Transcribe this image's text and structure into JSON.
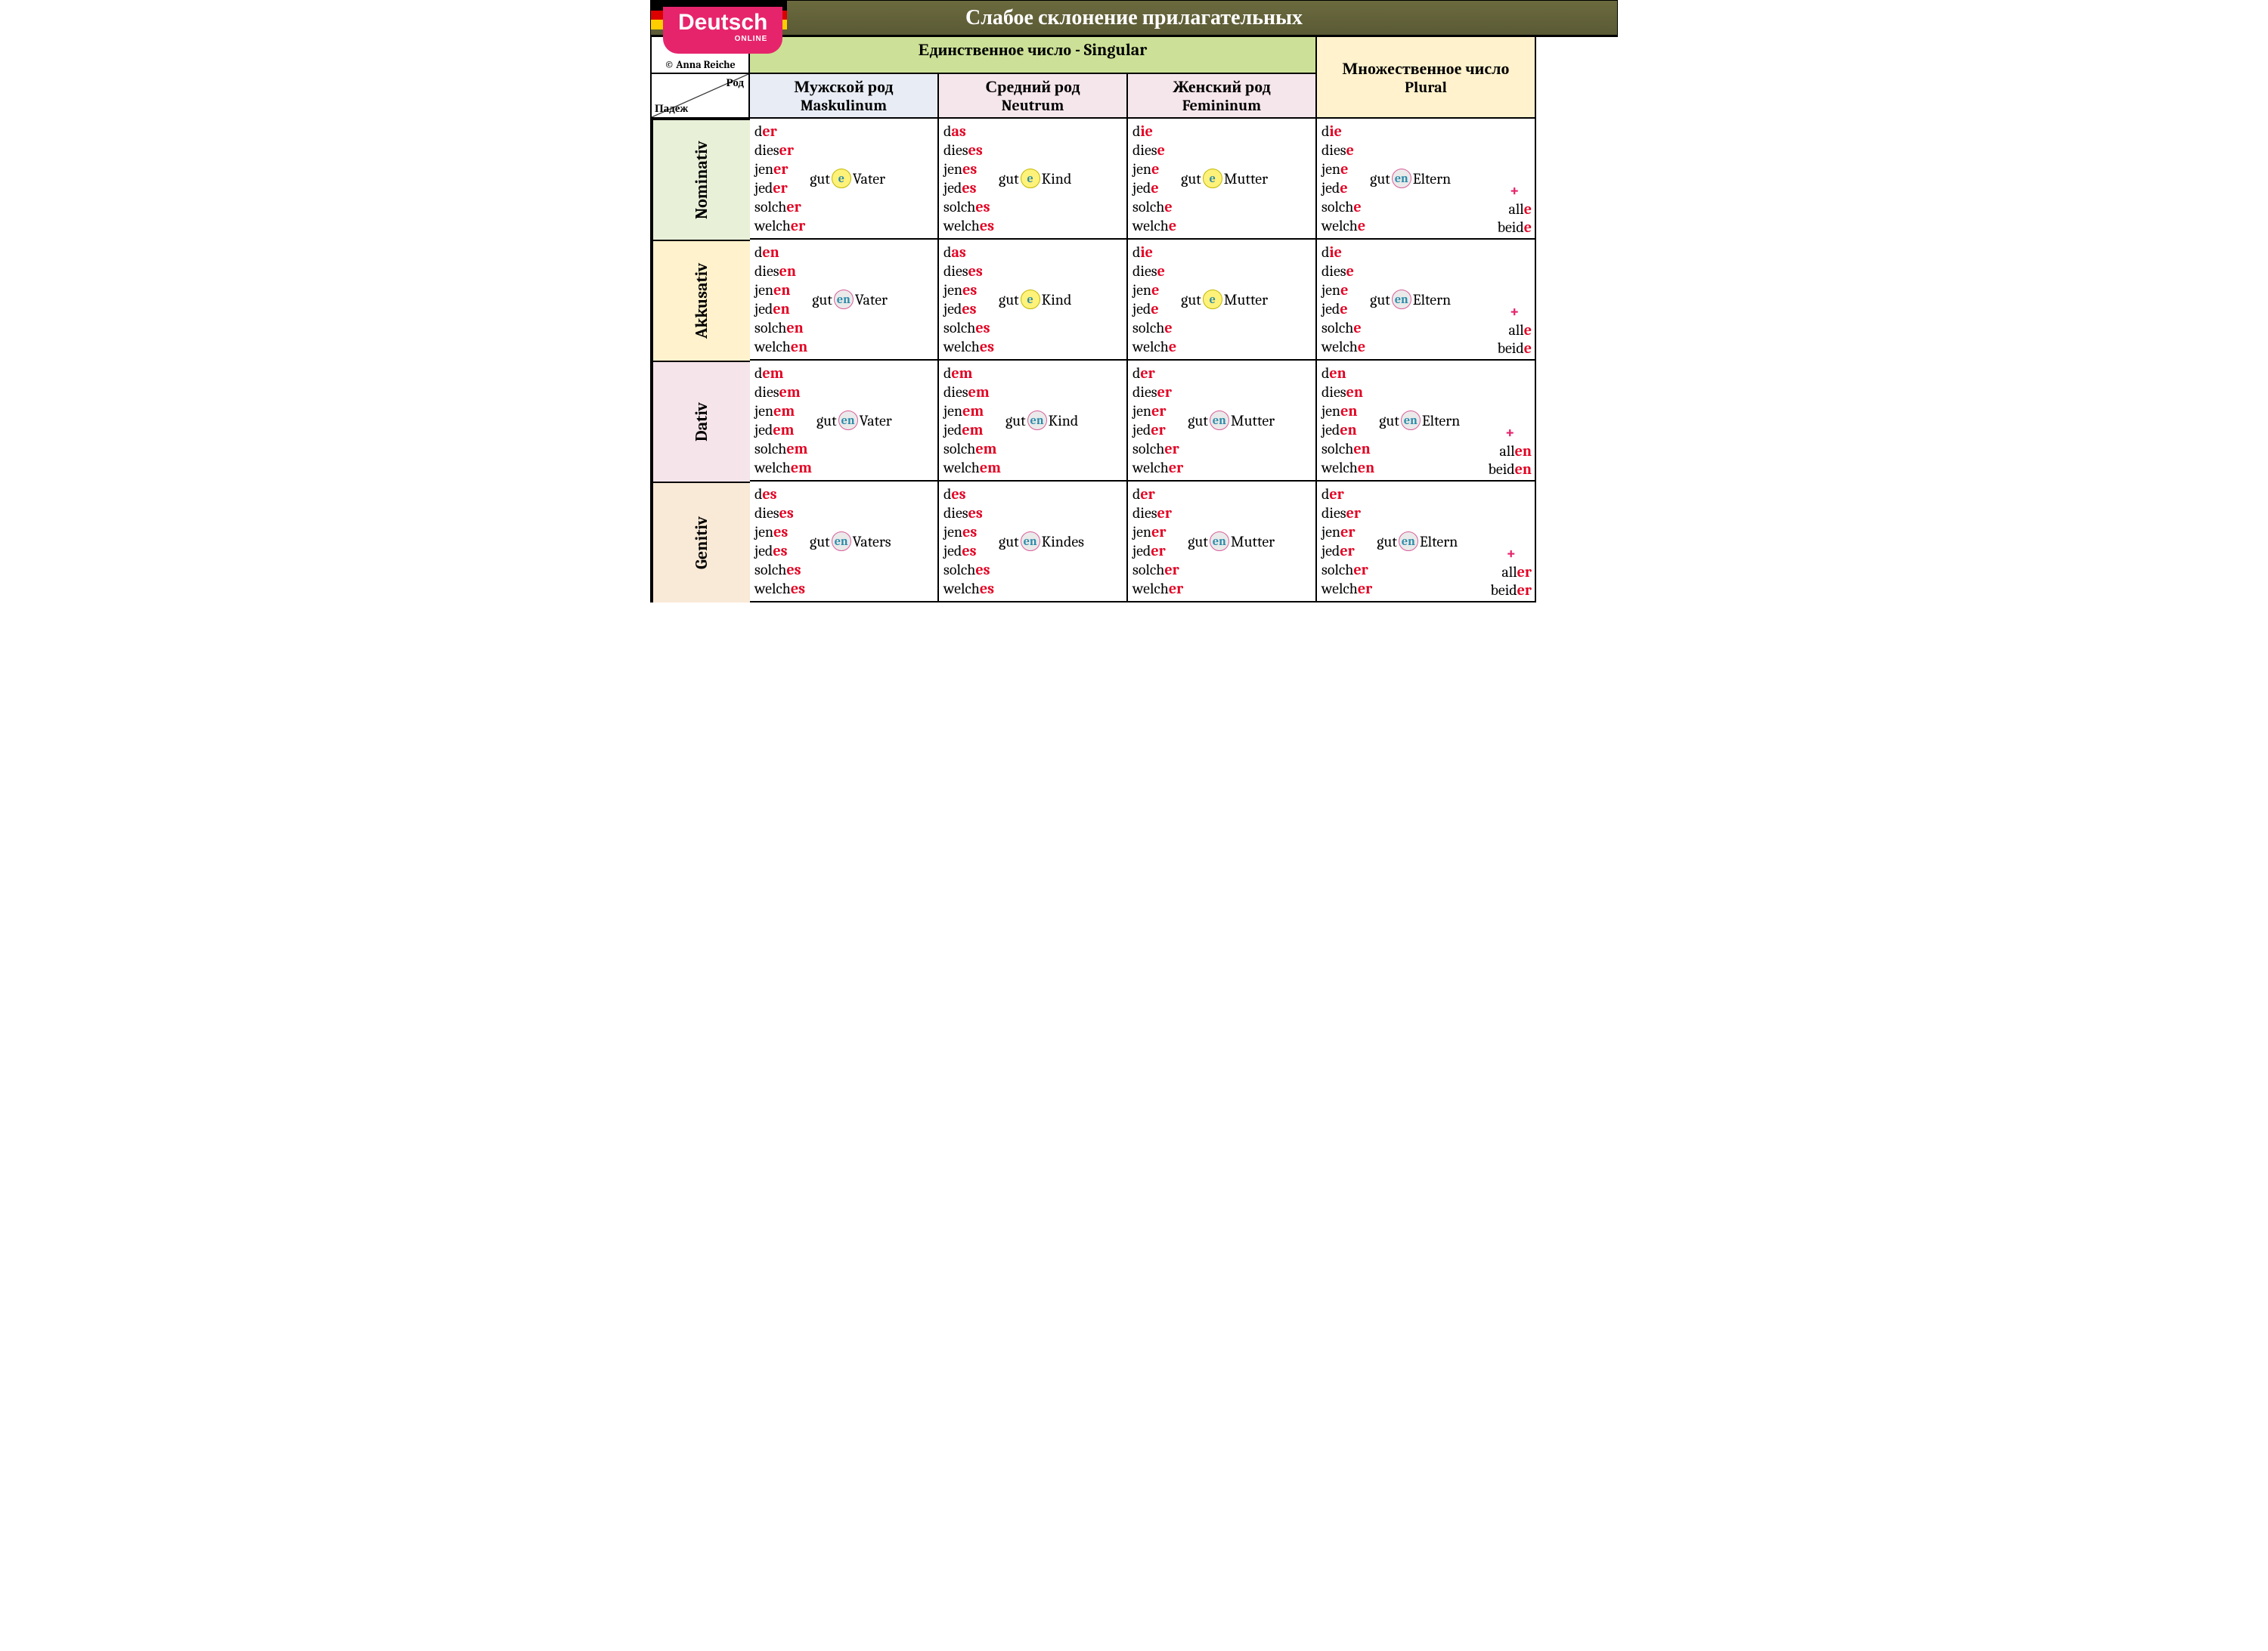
{
  "title": "Слабое склонение прилагательных",
  "logo": {
    "main": "Deutsch",
    "sub": "ONLINE"
  },
  "credit": "© Anna Reiche",
  "headers": {
    "singular": "Единственное число   -   Singular",
    "plural": "Множественное число",
    "plural_sub": "Plural",
    "rod": "Род",
    "padezh": "Падеж",
    "cols": [
      {
        "ru": "Мужской род",
        "de": "Maskulinum"
      },
      {
        "ru": "Средний род",
        "de": "Neutrum"
      },
      {
        "ru": "Женский род",
        "de": "Femininum"
      }
    ]
  },
  "cases": [
    "Nominativ",
    "Akkusativ",
    "Dativ",
    "Genitiv"
  ],
  "case_bg": [
    "bg-mint",
    "bg-yellow",
    "bg-rose",
    "bg-peach"
  ],
  "adj_stem": "gut",
  "nouns": {
    "m": "Vater",
    "n": "Kind",
    "f": "Mutter",
    "p": "Eltern",
    "m_gen": "Vaters",
    "n_gen": "Kindes"
  },
  "rows": [
    {
      "m": {
        "det": [
          [
            "d",
            "er"
          ],
          [
            "dies",
            "er"
          ],
          [
            "jen",
            "er"
          ],
          [
            "jed",
            "er"
          ],
          [
            "solch",
            "er"
          ],
          [
            "welch",
            "er"
          ]
        ],
        "end": "e",
        "circ": "e",
        "noun": "Vater"
      },
      "n": {
        "det": [
          [
            "d",
            "as"
          ],
          [
            "dies",
            "es"
          ],
          [
            "jen",
            "es"
          ],
          [
            "jed",
            "es"
          ],
          [
            "solch",
            "es"
          ],
          [
            "welch",
            "es"
          ]
        ],
        "end": "e",
        "circ": "e",
        "noun": "Kind"
      },
      "f": {
        "det": [
          [
            "d",
            "ie"
          ],
          [
            "dies",
            "e"
          ],
          [
            "jen",
            "e"
          ],
          [
            "jed",
            "e"
          ],
          [
            "solch",
            "e"
          ],
          [
            "welch",
            "e"
          ]
        ],
        "end": "e",
        "circ": "e",
        "noun": "Mutter"
      },
      "p": {
        "det": [
          [
            "d",
            "ie"
          ],
          [
            "dies",
            "e"
          ],
          [
            "jen",
            "e"
          ],
          [
            "jed",
            "e"
          ],
          [
            "solch",
            "e"
          ],
          [
            "welch",
            "e"
          ]
        ],
        "end": "en",
        "circ": "en",
        "noun": "Eltern",
        "extra": [
          [
            "all",
            "e"
          ],
          [
            "beid",
            "e"
          ]
        ]
      }
    },
    {
      "m": {
        "det": [
          [
            "d",
            "en"
          ],
          [
            "dies",
            "en"
          ],
          [
            "jen",
            "en"
          ],
          [
            "jed",
            "en"
          ],
          [
            "solch",
            "en"
          ],
          [
            "welch",
            "en"
          ]
        ],
        "end": "en",
        "circ": "en",
        "noun": "Vater"
      },
      "n": {
        "det": [
          [
            "d",
            "as"
          ],
          [
            "dies",
            "es"
          ],
          [
            "jen",
            "es"
          ],
          [
            "jed",
            "es"
          ],
          [
            "solch",
            "es"
          ],
          [
            "welch",
            "es"
          ]
        ],
        "end": "e",
        "circ": "e",
        "noun": "Kind"
      },
      "f": {
        "det": [
          [
            "d",
            "ie"
          ],
          [
            "dies",
            "e"
          ],
          [
            "jen",
            "e"
          ],
          [
            "jed",
            "e"
          ],
          [
            "solch",
            "e"
          ],
          [
            "welch",
            "e"
          ]
        ],
        "end": "e",
        "circ": "e",
        "noun": "Mutter"
      },
      "p": {
        "det": [
          [
            "d",
            "ie"
          ],
          [
            "dies",
            "e"
          ],
          [
            "jen",
            "e"
          ],
          [
            "jed",
            "e"
          ],
          [
            "solch",
            "e"
          ],
          [
            "welch",
            "e"
          ]
        ],
        "end": "en",
        "circ": "en",
        "noun": "Eltern",
        "extra": [
          [
            "all",
            "e"
          ],
          [
            "beid",
            "e"
          ]
        ]
      }
    },
    {
      "m": {
        "det": [
          [
            "d",
            "em"
          ],
          [
            "dies",
            "em"
          ],
          [
            "jen",
            "em"
          ],
          [
            "jed",
            "em"
          ],
          [
            "solch",
            "em"
          ],
          [
            "welch",
            "em"
          ]
        ],
        "end": "en",
        "circ": "en",
        "noun": "Vater"
      },
      "n": {
        "det": [
          [
            "d",
            "em"
          ],
          [
            "dies",
            "em"
          ],
          [
            "jen",
            "em"
          ],
          [
            "jed",
            "em"
          ],
          [
            "solch",
            "em"
          ],
          [
            "welch",
            "em"
          ]
        ],
        "end": "en",
        "circ": "en",
        "noun": "Kind"
      },
      "f": {
        "det": [
          [
            "d",
            "er"
          ],
          [
            "dies",
            "er"
          ],
          [
            "jen",
            "er"
          ],
          [
            "jed",
            "er"
          ],
          [
            "solch",
            "er"
          ],
          [
            "welch",
            "er"
          ]
        ],
        "end": "en",
        "circ": "en",
        "noun": "Mutter"
      },
      "p": {
        "det": [
          [
            "d",
            "en"
          ],
          [
            "dies",
            "en"
          ],
          [
            "jen",
            "en"
          ],
          [
            "jed",
            "en"
          ],
          [
            "solch",
            "en"
          ],
          [
            "welch",
            "en"
          ]
        ],
        "end": "en",
        "circ": "en",
        "noun": "Eltern",
        "extra": [
          [
            "all",
            "en"
          ],
          [
            "beid",
            "en"
          ]
        ]
      }
    },
    {
      "m": {
        "det": [
          [
            "d",
            "es"
          ],
          [
            "dies",
            "es"
          ],
          [
            "jen",
            "es"
          ],
          [
            "jed",
            "es"
          ],
          [
            "solch",
            "es"
          ],
          [
            "welch",
            "es"
          ]
        ],
        "end": "en",
        "circ": "en",
        "noun": "Vaters"
      },
      "n": {
        "det": [
          [
            "d",
            "es"
          ],
          [
            "dies",
            "es"
          ],
          [
            "jen",
            "es"
          ],
          [
            "jed",
            "es"
          ],
          [
            "solch",
            "es"
          ],
          [
            "welch",
            "es"
          ]
        ],
        "end": "en",
        "circ": "en",
        "noun": "Kindes"
      },
      "f": {
        "det": [
          [
            "d",
            "er"
          ],
          [
            "dies",
            "er"
          ],
          [
            "jen",
            "er"
          ],
          [
            "jed",
            "er"
          ],
          [
            "solch",
            "er"
          ],
          [
            "welch",
            "er"
          ]
        ],
        "end": "en",
        "circ": "en",
        "noun": "Mutter"
      },
      "p": {
        "det": [
          [
            "d",
            "er"
          ],
          [
            "dies",
            "er"
          ],
          [
            "jen",
            "er"
          ],
          [
            "jed",
            "er"
          ],
          [
            "solch",
            "er"
          ],
          [
            "welch",
            "er"
          ]
        ],
        "end": "en",
        "circ": "en",
        "noun": "Eltern",
        "extra": [
          [
            "all",
            "er"
          ],
          [
            "beid",
            "er"
          ]
        ]
      }
    }
  ],
  "plus": "+"
}
